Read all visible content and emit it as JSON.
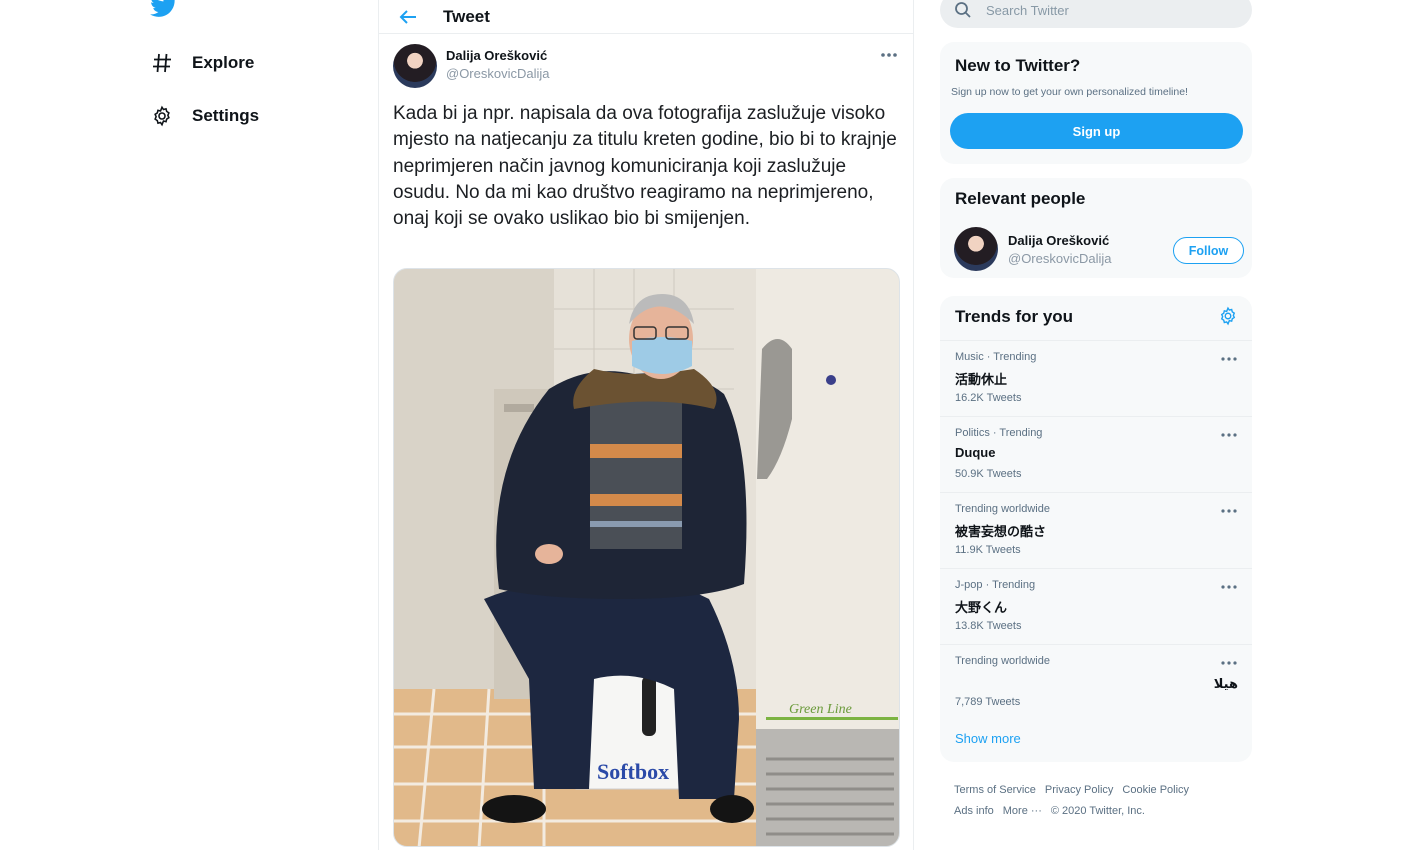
{
  "nav": {
    "items": [
      {
        "label": "Explore",
        "icon": "hashtag-icon"
      },
      {
        "label": "Settings",
        "icon": "gear-icon"
      }
    ]
  },
  "header": {
    "title": "Tweet"
  },
  "tweet": {
    "author_name": "Dalija Orešković",
    "author_handle": "@OreskovicDalija",
    "text": "Kada bi ja npr. napisala da ova fotografija zaslužuje visoko mjesto na natjecanju za titulu kreten godine, bio bi to krajnje neprimjeren način javnog komuniciranja koji zaslužuje osudu. No da mi kao društvo reagiramo na neprimjereno, onaj koji se ovako uslikao bio bi smijenjen.",
    "photo": {
      "box_label": "Softbox",
      "freezer_label": "Green Line"
    }
  },
  "search": {
    "placeholder": "Search Twitter"
  },
  "new_to_twitter": {
    "title": "New to Twitter?",
    "subtitle": "Sign up now to get your own personalized timeline!",
    "button": "Sign up"
  },
  "relevant_people": {
    "title": "Relevant people",
    "person": {
      "name": "Dalija Orešković",
      "handle": "@OreskovicDalija",
      "button": "Follow"
    }
  },
  "trends": {
    "title": "Trends for you",
    "items": [
      {
        "meta": "Music · Trending",
        "name": "活動休止",
        "count": "16.2K Tweets"
      },
      {
        "meta": "Politics · Trending",
        "name": "Duque",
        "count": "50.9K Tweets"
      },
      {
        "meta": "Trending worldwide",
        "name": "被害妄想の酷さ",
        "count": "11.9K Tweets"
      },
      {
        "meta": "J-pop · Trending",
        "name": "大野くん",
        "count": "13.8K Tweets"
      },
      {
        "meta": "Trending worldwide",
        "name": "هيلا",
        "count": "7,789 Tweets"
      }
    ],
    "show_more": "Show more"
  },
  "footer": {
    "links": [
      "Terms of Service",
      "Privacy Policy",
      "Cookie Policy",
      "Ads info",
      "More ···",
      "© 2020 Twitter, Inc."
    ]
  },
  "colors": {
    "accent": "#1da1f2",
    "text": "#0f1419",
    "muted": "#5b7083",
    "panel": "#f7f9fa"
  }
}
